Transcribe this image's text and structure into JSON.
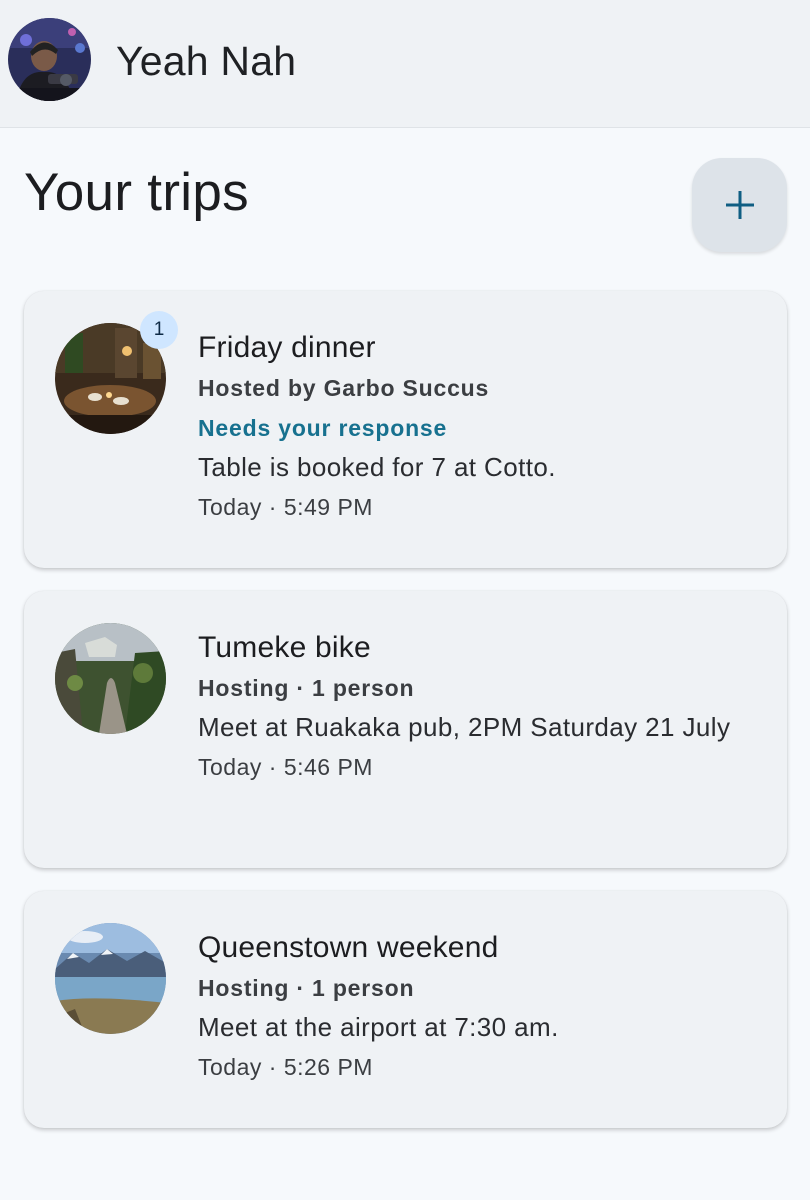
{
  "header": {
    "app_name": "Yeah Nah"
  },
  "main": {
    "title": "Your trips",
    "add_icon": "plus-icon",
    "accent_color": "#0f5e83"
  },
  "trips": [
    {
      "title": "Friday dinner",
      "subtitle": "Hosted by Garbo Succus",
      "alert": "Needs your response",
      "badge": "1",
      "message": "Table is booked for 7 at Cotto.",
      "time": "Today · 5:49 PM",
      "image": "restaurant-photo"
    },
    {
      "title": "Tumeke bike",
      "subtitle": "Hosting · 1 person",
      "message": "Meet at Ruakaka pub, 2PM Saturday 21 July",
      "time": "Today · 5:46 PM",
      "image": "bike-trail-photo"
    },
    {
      "title": "Queenstown weekend",
      "subtitle": "Hosting · 1 person",
      "message": "Meet at the airport at 7:30 am.",
      "time": "Today · 5:26 PM",
      "image": "lake-mountains-photo"
    }
  ]
}
